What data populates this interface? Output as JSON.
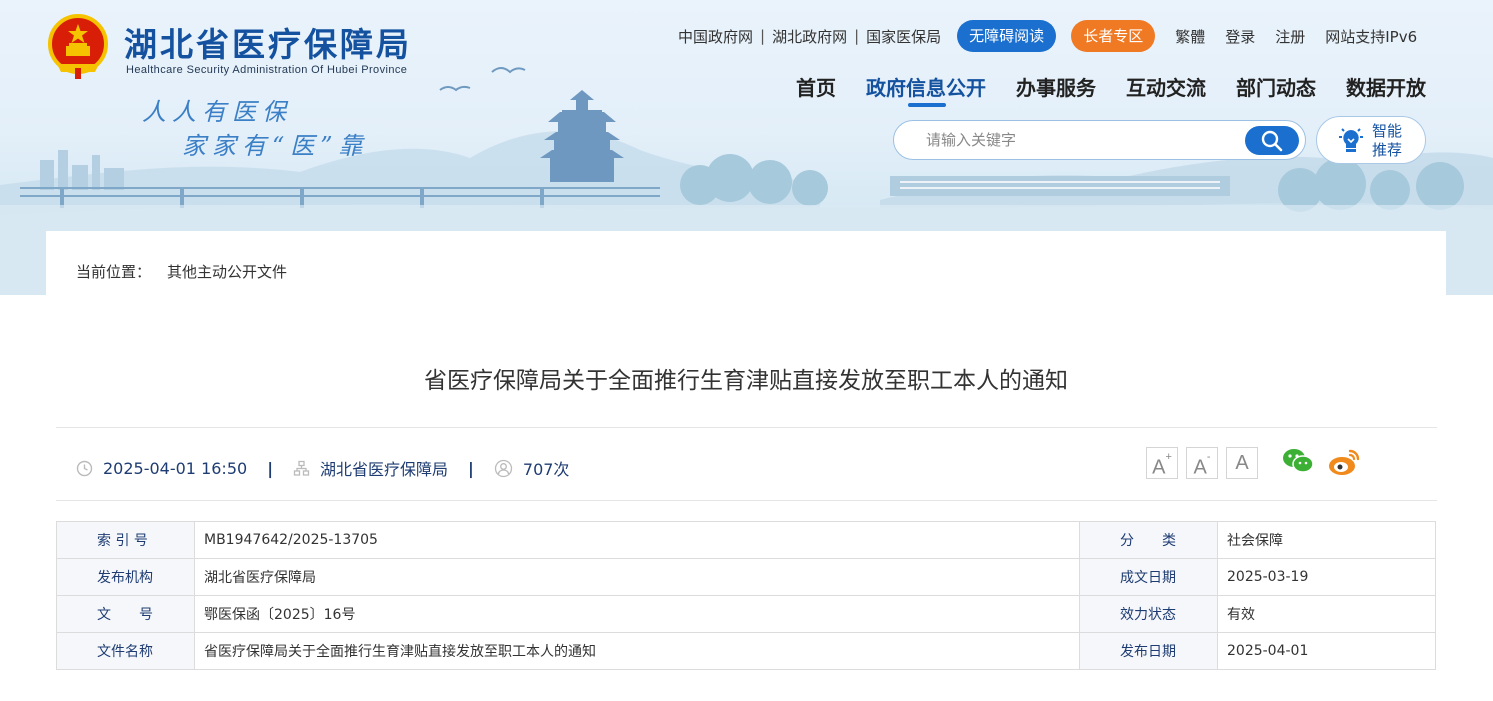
{
  "header": {
    "title": "湖北省医疗保障局",
    "subtitle": "Healthcare Security Administration Of Hubei Province",
    "slogan_line1": "人人有医保",
    "slogan_line2": "家家有“医”靠"
  },
  "top_links": {
    "gov_cn": "中国政府网",
    "hubei_gov": "湖北政府网",
    "nhsa": "国家医保局",
    "accessible": "无障碍阅读",
    "elderly": "长者专区",
    "traditional": "繁體",
    "login": "登录",
    "register": "注册",
    "ipv6": "网站支持IPv6"
  },
  "nav": {
    "items": [
      "首页",
      "政府信息公开",
      "办事服务",
      "互动交流",
      "部门动态",
      "数据开放"
    ],
    "active_index": 1
  },
  "search": {
    "placeholder": "请输入关键字",
    "smart_label": "智能推荐"
  },
  "breadcrumb": {
    "label": "当前位置：",
    "current": "其他主动公开文件"
  },
  "article": {
    "title": "省医疗保障局关于全面推行生育津贴直接发放至职工本人的通知",
    "date": "2025-04-01 16:50",
    "source": "湖北省医疗保障局",
    "views": "707次",
    "font_buttons": [
      "A+",
      "A-",
      "A"
    ]
  },
  "info_table": {
    "rows": [
      {
        "label": "索 引 号",
        "value": "MB1947642/2025-13705",
        "label2": "分　　类",
        "value2": "社会保障"
      },
      {
        "label": "发布机构",
        "value": "湖北省医疗保障局",
        "label2": "成文日期",
        "value2": "2025-03-19"
      },
      {
        "label": "文　　号",
        "value": "鄂医保函〔2025〕16号",
        "label2": "效力状态",
        "value2": "有效"
      },
      {
        "label": "文件名称",
        "value": "省医疗保障局关于全面推行生育津贴直接发放至职工本人的通知",
        "label2": "发布日期",
        "value2": "2025-04-01"
      }
    ]
  },
  "colors": {
    "brand_blue": "#1452a0",
    "accent_blue": "#1b6fce",
    "accent_orange": "#f07923",
    "wechat_green": "#3cb034",
    "weibo_orange": "#f08a1c"
  },
  "icons": [
    "national-emblem-icon",
    "search-icon",
    "bulb-icon",
    "clock-icon",
    "org-icon",
    "user-icon",
    "wechat-icon",
    "weibo-icon"
  ]
}
